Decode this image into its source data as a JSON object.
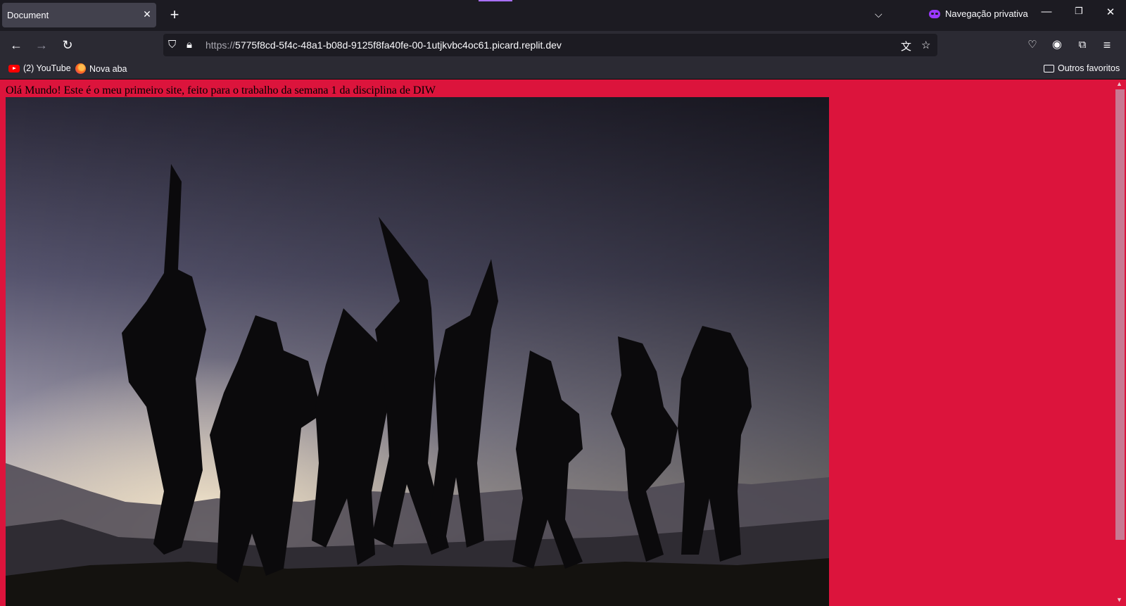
{
  "browser": {
    "tab": {
      "title": "Document"
    },
    "private_label": "Navegação privativa",
    "url": {
      "scheme": "https://",
      "host": "5775f8cd-5f4c-48a1-b08d-9125f8fa40fe-00-1utjkvbc4oc61.picard.replit.dev"
    },
    "bookmarks": [
      {
        "label": "(2) YouTube",
        "icon": "youtube-icon"
      },
      {
        "label": "Nova aba",
        "icon": "firefox-icon"
      }
    ],
    "other_bookmarks": "Outros favoritos"
  },
  "page": {
    "background": "#dc143c",
    "text": "Olá Mundo! Este é o meu primeiro site, feito para o trabalho da semana 1 da disciplina de DIW"
  },
  "colors": {
    "chrome_dark": "#1c1b22",
    "toolbar": "#2b2a33",
    "private_accent": "#9a38ff"
  }
}
